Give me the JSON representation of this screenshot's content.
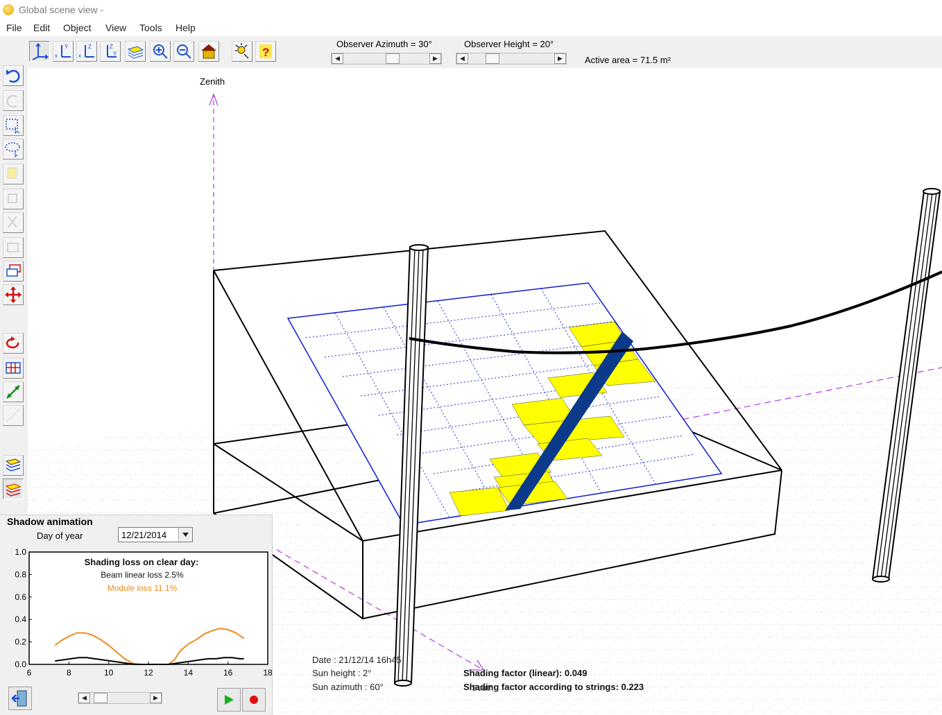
{
  "window": {
    "title": "Global scene view  -"
  },
  "menu": [
    "File",
    "Edit",
    "Object",
    "View",
    "Tools",
    "Help"
  ],
  "toolbar": {
    "tools": [
      "hand-icon",
      "axes-3d-icon",
      "view-xy-icon",
      "view-xz-icon",
      "view-yz-icon",
      "layers-view-icon",
      "zoom-in-icon",
      "zoom-out-icon",
      "house-icon",
      "sun-icon",
      "help-icon"
    ],
    "observer_azimuth_label": "Observer Azimuth =   30°",
    "observer_azimuth": 30,
    "observer_height_label": "Observer Height =   20°",
    "observer_height": 20,
    "active_area": "Active area = 71.5 m²"
  },
  "sidebar": {
    "tools": [
      "undo-icon",
      "redo-icon",
      "rect-select-icon",
      "lasso-select-icon",
      "copy-icon",
      "paste-icon",
      "cut-icon",
      "group-icon",
      "layers-object-icon",
      "move-icon",
      "rotate-icon",
      "table-icon",
      "line-icon",
      "dotted-line-icon",
      "layers-icon",
      "layers-active-icon"
    ]
  },
  "scene": {
    "zenith_label": "Zenith",
    "south_label": "South",
    "date_label": "Date :  21/12/14 16h45",
    "sun_height_label": "Sun height :  2°",
    "sun_azimuth_label": "Sun azimuth :  60°",
    "shading_linear_label": "Shading factor (linear):  0.049",
    "shading_strings_label": "Shading factor according to strings:  0.223"
  },
  "shadow_animation": {
    "title": "Shadow animation",
    "day_of_year_label": "Day of year",
    "date_value": "12/21/2014",
    "chart_title": "Shading loss on clear day:",
    "beam_loss_label": "Beam linear loss 2.5%",
    "module_loss_label": "Module loss 11.1%",
    "colors": {
      "beam": "#000000",
      "module": "#f08a1e"
    }
  },
  "chart_data": {
    "type": "line",
    "title": "Shading loss on clear day:",
    "xlim": [
      6,
      18
    ],
    "ylim": [
      0.0,
      1.0
    ],
    "xticks": [
      "6",
      "8",
      "10",
      "12",
      "14",
      "16",
      "18"
    ],
    "yticks": [
      "0.0",
      "0.2",
      "0.4",
      "0.6",
      "0.8",
      "1.0"
    ],
    "series": [
      {
        "name": "Module loss 11.1%",
        "color": "#f08a1e",
        "x": [
          7.3,
          7.6,
          8.0,
          8.4,
          8.8,
          9.2,
          9.6,
          10.0,
          10.4,
          10.8,
          11.2,
          11.6,
          12.0,
          12.5,
          13.0,
          13.3,
          13.6,
          14.0,
          14.4,
          14.8,
          15.2,
          15.6,
          16.0,
          16.4,
          16.8
        ],
        "y": [
          0.17,
          0.21,
          0.25,
          0.28,
          0.28,
          0.26,
          0.22,
          0.17,
          0.11,
          0.05,
          0.01,
          0.0,
          0.0,
          0.0,
          0.0,
          0.04,
          0.12,
          0.18,
          0.22,
          0.27,
          0.3,
          0.32,
          0.31,
          0.28,
          0.23
        ]
      },
      {
        "name": "Beam linear loss 2.5%",
        "color": "#000000",
        "x": [
          7.3,
          7.7,
          8.1,
          8.5,
          8.9,
          9.3,
          9.7,
          10.1,
          10.5,
          10.9,
          11.3,
          11.7,
          12.0,
          12.5,
          13.0,
          13.4,
          13.8,
          14.2,
          14.6,
          15.0,
          15.4,
          15.8,
          16.2,
          16.6,
          16.8
        ],
        "y": [
          0.03,
          0.04,
          0.05,
          0.06,
          0.06,
          0.05,
          0.04,
          0.03,
          0.02,
          0.01,
          0.0,
          0.0,
          0.0,
          0.0,
          0.0,
          0.01,
          0.02,
          0.03,
          0.04,
          0.05,
          0.05,
          0.06,
          0.06,
          0.05,
          0.05
        ]
      }
    ]
  }
}
